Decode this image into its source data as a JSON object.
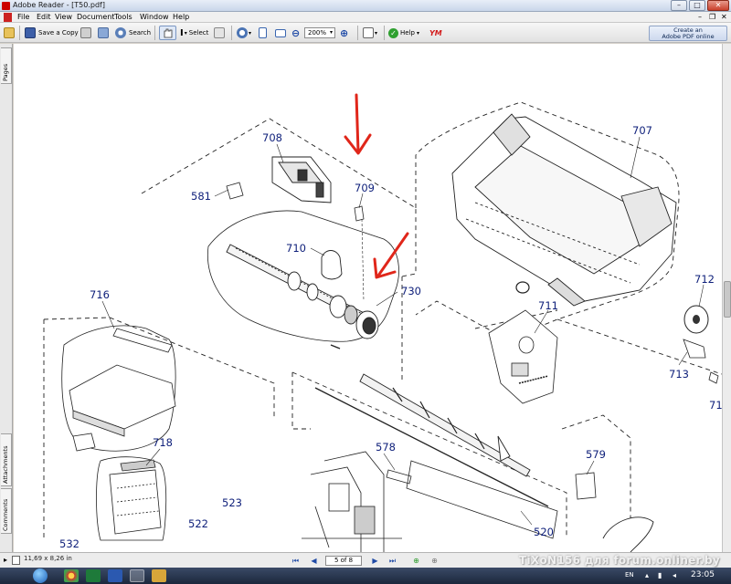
{
  "window": {
    "title": "Adobe Reader - [T50.pdf]",
    "controls": {
      "minimize": "–",
      "maximize": "□",
      "close": "✕"
    }
  },
  "menubar": {
    "items": [
      {
        "label": "File"
      },
      {
        "label": "Edit"
      },
      {
        "label": "View"
      },
      {
        "label": "Document"
      },
      {
        "label": "Tools"
      },
      {
        "label": "Window"
      },
      {
        "label": "Help"
      }
    ],
    "doc_controls": {
      "minimize": "–",
      "restore": "❐",
      "close": "✕"
    }
  },
  "toolbar": {
    "save_copy": "Save a Copy",
    "search": "Search",
    "select": "Select",
    "zoom_value": "200%",
    "help": "Help",
    "create_pdf_line1": "Create an",
    "create_pdf_line2": "Adobe PDF online"
  },
  "nav_tabs": {
    "pages": "Pages",
    "attachments": "Attachments",
    "comments": "Comments"
  },
  "statusbar": {
    "page_size": "11,69 x 8,26 in",
    "page_indicator": "5 of 8",
    "watermark": "TiXoN156 для forum.onliner.by"
  },
  "taskbar": {
    "language": "EN",
    "time": "23:05"
  },
  "diagram": {
    "labels": [
      "707",
      "708",
      "709",
      "581",
      "710",
      "730",
      "716",
      "711",
      "712",
      "713",
      "71",
      "718",
      "578",
      "579",
      "523",
      "522",
      "520",
      "532"
    ]
  },
  "colors": {
    "callout_blue": "#0e1f7a",
    "annotation_red": "#e0261a"
  }
}
